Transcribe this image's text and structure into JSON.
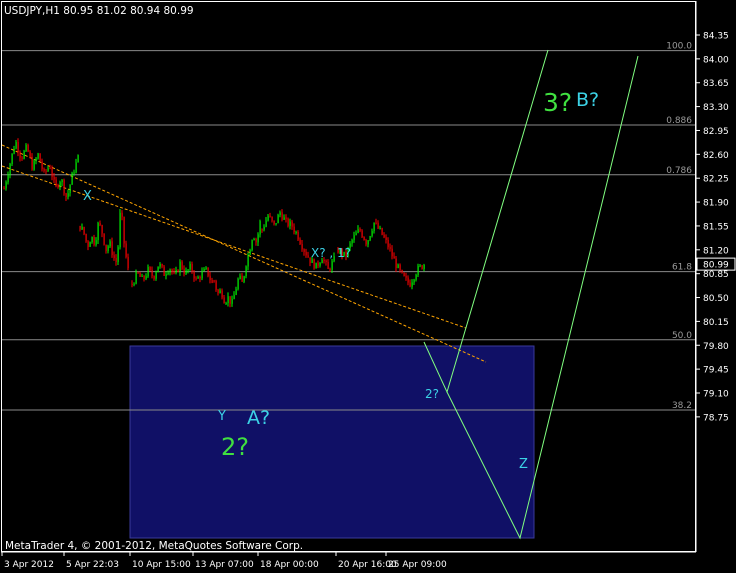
{
  "chart_header": "USDJPY,H1  80.95 81.02 80.94 80.99",
  "watermark": "MetaTrader 4, © 2001-2012, MetaQuotes Software Corp.",
  "colors": {
    "background": "#000000",
    "axis_text": "#ffffff",
    "grid_line": "#8a8a8a",
    "fib_label": "#9a9a9a",
    "bull_candle": "#00ff00",
    "bear_candle": "#ff0000",
    "trendline": "#ffa500",
    "projection": "#80ff80",
    "label_cyan": "#3cd2e6",
    "label_green": "#40e040",
    "rectangle_fill": "#101066",
    "rectangle_border": "#3a3a9a",
    "current_price_box": "#000000"
  },
  "chart_data": {
    "type": "candlestick",
    "symbol": "USDJPY",
    "timeframe": "H1",
    "ohlc_latest": {
      "open": 80.95,
      "high": 81.02,
      "low": 80.94,
      "close": 80.99
    },
    "ylim": [
      78.75,
      84.55
    ],
    "y_ticks": [
      "84.35",
      "84.00",
      "83.65",
      "83.30",
      "82.95",
      "82.60",
      "82.25",
      "81.90",
      "81.55",
      "81.20",
      "80.85",
      "80.50",
      "80.15",
      "79.80",
      "79.45",
      "79.10",
      "78.75"
    ],
    "x_tick_labels": [
      "3 Apr 2012",
      "5 Apr 22:03",
      "10 Apr 15:00",
      "13 Apr 07:00",
      "18 Apr 00:00",
      "20 Apr 16:00",
      "25 Apr 09:00"
    ],
    "current_price": "80.99",
    "fib_levels": [
      {
        "label": "100.0",
        "value": 84.12
      },
      {
        "label": "0.886",
        "value": 83.03
      },
      {
        "label": "0.786",
        "value": 82.3
      },
      {
        "label": "61.8",
        "value": 80.88
      },
      {
        "label": "50.0",
        "value": 79.88
      },
      {
        "label": "38.2",
        "value": 78.85
      }
    ],
    "price_path": [
      [
        82.1,
        82.45,
        82.8,
        82.55,
        82.7,
        82.4,
        82.6,
        82.3,
        82.45,
        82.1,
        82.25,
        81.95,
        82.3,
        82.55
      ],
      [
        81.55,
        81.45,
        81.25,
        81.4,
        81.3,
        81.6,
        81.45,
        81.2,
        81.3,
        81.1,
        81.0,
        81.85,
        81.25,
        80.9
      ],
      [
        80.7,
        80.85,
        80.75,
        80.9,
        80.8,
        81.0,
        80.85,
        80.95,
        80.8,
        81.0,
        80.85,
        80.95,
        80.75,
        80.85,
        80.9,
        80.7
      ],
      [
        80.75,
        80.55,
        80.6,
        80.45,
        80.5,
        80.4,
        80.6,
        80.8,
        80.7,
        81.0,
        81.2,
        81.45,
        81.3,
        81.6
      ],
      [
        81.5,
        81.7,
        81.55,
        81.75,
        81.6,
        81.55,
        81.4,
        81.2,
        81.05,
        80.95,
        81.1,
        80.9,
        81.05
      ],
      [
        81.2,
        81.1,
        81.35,
        81.5,
        81.3,
        81.6,
        81.45,
        81.25,
        81.0,
        80.8,
        80.7,
        80.9,
        80.99
      ]
    ],
    "annotations": [
      {
        "text": "X",
        "color": "cyan"
      },
      {
        "text": "X? , 1?",
        "color": "cyan"
      },
      {
        "text": "Y",
        "color": "cyan"
      },
      {
        "text": "A?",
        "color": "cyan"
      },
      {
        "text": "2?",
        "color": "green"
      },
      {
        "text": "2?",
        "color": "cyan"
      },
      {
        "text": "Z",
        "color": "cyan"
      },
      {
        "text": "3?",
        "color": "green"
      },
      {
        "text": "B?",
        "color": "cyan"
      }
    ]
  }
}
